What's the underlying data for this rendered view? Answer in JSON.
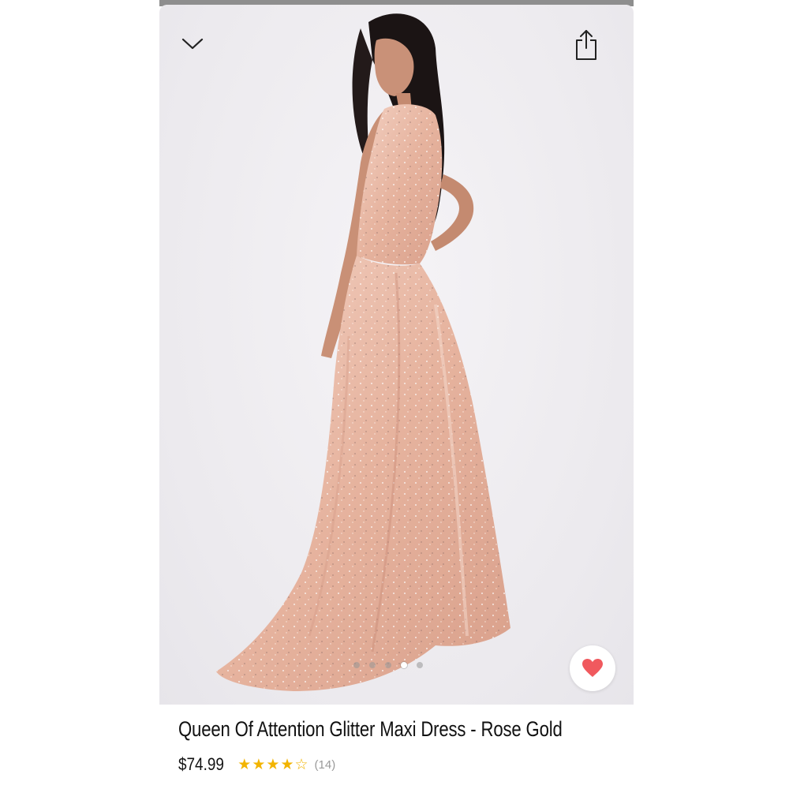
{
  "product": {
    "title": "Queen Of Attention Glitter Maxi Dress - Rose Gold",
    "price": "$74.99",
    "rating": 4,
    "rating_max": 5,
    "review_count": "(14)"
  },
  "gallery": {
    "image_count": 5,
    "active_index": 3
  },
  "icons": {
    "collapse": "chevron-down-icon",
    "share": "share-icon",
    "favorite": "heart-icon"
  },
  "colors": {
    "heart": "#f0595e",
    "star": "#f2b400",
    "dress": "#e9b7a2"
  }
}
